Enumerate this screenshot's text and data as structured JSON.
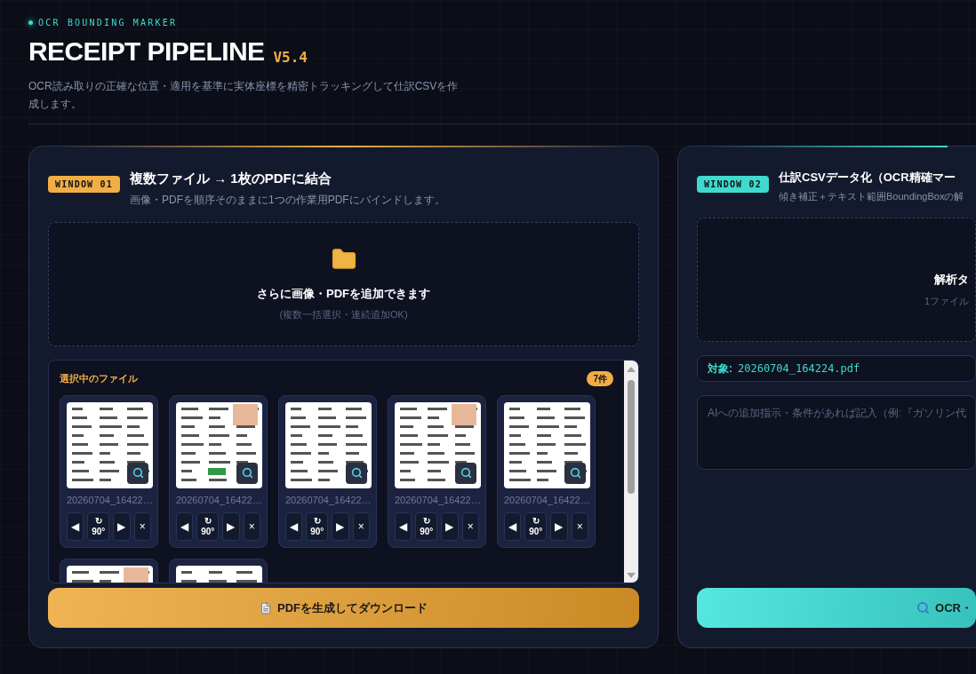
{
  "header": {
    "eyebrow": "OCR BOUNDING MARKER",
    "title": "RECEIPT PIPELINE",
    "version": "V5.4",
    "description": "OCR読み取りの正確な位置・適用を基準に実体座標を精密トラッキングして仕訳CSVを作成します。"
  },
  "windows": [
    {
      "kind": "merge",
      "badge": "WINDOW 01",
      "title": "複数ファイル → 1枚のPDFに結合",
      "subtitle": "画像・PDFを順序そのままに1つの作業用PDFにバインドします。",
      "dropzone": {
        "title": "さらに画像・PDFを追加できます",
        "hint": "(複数一括選択・連続追加OK)"
      },
      "file_list": {
        "heading": "選択中のファイル",
        "count": "7件",
        "files": [
          {
            "name": "20260704_16422…",
            "controls": [
              {
                "icon": "◀"
              },
              {
                "icon": "↻",
                "label": "90°"
              },
              {
                "icon": "▶"
              },
              {
                "icon": "×"
              }
            ]
          },
          {
            "name": "20260704_16422…",
            "controls": [
              {
                "icon": "◀"
              },
              {
                "icon": "↻",
                "label": "90°"
              },
              {
                "icon": "▶"
              },
              {
                "icon": "×"
              }
            ]
          },
          {
            "name": "20260704_16422…",
            "controls": [
              {
                "icon": "◀"
              },
              {
                "icon": "↻",
                "label": "90°"
              },
              {
                "icon": "▶"
              },
              {
                "icon": "×"
              }
            ]
          },
          {
            "name": "20260704_16422…",
            "controls": [
              {
                "icon": "◀"
              },
              {
                "icon": "↻",
                "label": "90°"
              },
              {
                "icon": "▶"
              },
              {
                "icon": "×"
              }
            ]
          },
          {
            "name": "20260704_16422…",
            "controls": [
              {
                "icon": "◀"
              },
              {
                "icon": "↻",
                "label": "90°"
              },
              {
                "icon": "▶"
              },
              {
                "icon": "×"
              }
            ]
          },
          {
            "kind": "picture"
          },
          {
            "kind": "picture"
          }
        ]
      },
      "button": "PDFを生成してダウンロード"
    },
    {
      "kind": "ocr",
      "badge": "WINDOW 02",
      "title": "仕訳CSVデータ化（OCR精確マー",
      "subtitle": "傾き補正＋テキスト範囲BoundingBoxの解",
      "dropzone": {
        "title": "解析タ",
        "hint": "1ファイル"
      },
      "target": {
        "label": "対象:",
        "value": "20260704_164224.pdf"
      },
      "instructions": {
        "placeholder": "AIへの追加指示・条件があれば記入（例:『ガソリン代"
      },
      "button": "OCR・"
    }
  ]
}
